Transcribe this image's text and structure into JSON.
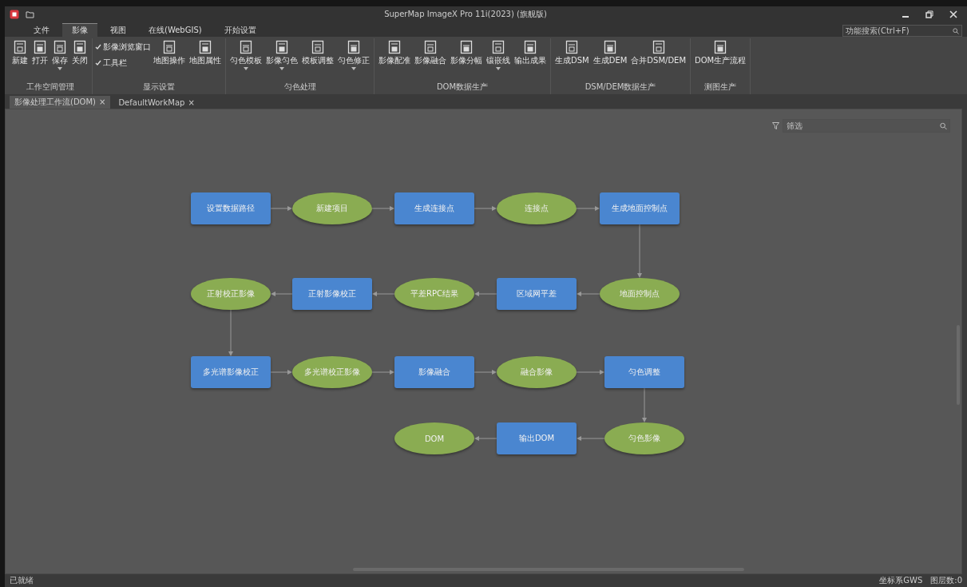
{
  "window": {
    "title": "SuperMap ImageX Pro 11i(2023) (旗舰版)",
    "search": {
      "placeholder": "功能搜索(Ctrl+F)"
    }
  },
  "menu_tabs": [
    {
      "label": "文件",
      "selected": false
    },
    {
      "label": "影像",
      "selected": true
    },
    {
      "label": "视图",
      "selected": false
    },
    {
      "label": "在线(WebGIS)",
      "selected": false
    },
    {
      "label": "开始设置",
      "selected": false
    }
  ],
  "ribbon_groups": [
    {
      "label": "工作空间管理",
      "items": [
        {
          "kind": "button",
          "label": "新建"
        },
        {
          "kind": "button",
          "label": "打开"
        },
        {
          "kind": "button",
          "label": "保存",
          "dropdown": true
        },
        {
          "kind": "button",
          "label": "关闭"
        }
      ]
    },
    {
      "label": "显示设置",
      "items": [
        {
          "kind": "checks",
          "checks": [
            {
              "label": "影像浏览窗口",
              "checked": true
            },
            {
              "label": "工具栏",
              "checked": true
            }
          ]
        },
        {
          "kind": "button",
          "label": "地图操作"
        },
        {
          "kind": "button",
          "label": "地图属性"
        }
      ]
    },
    {
      "label": "匀色处理",
      "items": [
        {
          "kind": "button",
          "label": "匀色模板",
          "dropdown": true
        },
        {
          "kind": "button",
          "label": "影像匀色",
          "dropdown": true
        },
        {
          "kind": "button",
          "label": "模板调整"
        },
        {
          "kind": "button",
          "label": "匀色修正",
          "dropdown": true
        }
      ]
    },
    {
      "label": "DOM数据生产",
      "items": [
        {
          "kind": "button",
          "label": "影像配准"
        },
        {
          "kind": "button",
          "label": "影像融合"
        },
        {
          "kind": "button",
          "label": "影像分幅"
        },
        {
          "kind": "button",
          "label": "镶嵌线",
          "dropdown": true
        },
        {
          "kind": "button",
          "label": "输出成果"
        }
      ]
    },
    {
      "label": "DSM/DEM数据生产",
      "items": [
        {
          "kind": "button",
          "label": "生成DSM"
        },
        {
          "kind": "button",
          "label": "生成DEM"
        },
        {
          "kind": "button",
          "label": "合并DSM/DEM"
        }
      ]
    },
    {
      "label": "测图生产",
      "items": [
        {
          "kind": "button",
          "label": "DOM生产流程"
        }
      ]
    }
  ],
  "document_tabs": [
    {
      "label": "影像处理工作流(DOM)",
      "close": "×",
      "selected": true
    },
    {
      "label": "DefaultWorkMap",
      "close": "×",
      "selected": false
    }
  ],
  "canvas": {
    "filter_placeholder": "筛选",
    "flow_rows": [
      {
        "leftward": false,
        "nodes": [
          {
            "kind": "process",
            "label": "设置数据路径"
          },
          {
            "kind": "data",
            "label": "新建项目"
          },
          {
            "kind": "process",
            "label": "生成连接点"
          },
          {
            "kind": "data",
            "label": "连接点"
          },
          {
            "kind": "process",
            "label": "生成地面控制点"
          }
        ]
      },
      {
        "leftward": true,
        "nodes": [
          {
            "kind": "data",
            "label": "正射校正影像"
          },
          {
            "kind": "process",
            "label": "正射影像校正"
          },
          {
            "kind": "data",
            "label": "平差RPC结果"
          },
          {
            "kind": "process",
            "label": "区域网平差"
          },
          {
            "kind": "data",
            "label": "地面控制点"
          }
        ]
      },
      {
        "leftward": false,
        "nodes": [
          {
            "kind": "process",
            "label": "多光谱影像校正"
          },
          {
            "kind": "data",
            "label": "多光谱校正影像"
          },
          {
            "kind": "process",
            "label": "影像融合"
          },
          {
            "kind": "data",
            "label": "融合影像"
          },
          {
            "kind": "process",
            "label": "匀色调整"
          }
        ]
      },
      {
        "leftward": true,
        "nodes": [
          {
            "kind": "data",
            "label": "DOM"
          },
          {
            "kind": "process",
            "label": "输出DOM"
          },
          {
            "kind": "data",
            "label": "匀色影像"
          }
        ]
      }
    ]
  },
  "status_bar": {
    "left": "已就绪",
    "right": [
      "坐标系GWS",
      "图层数:0"
    ]
  }
}
